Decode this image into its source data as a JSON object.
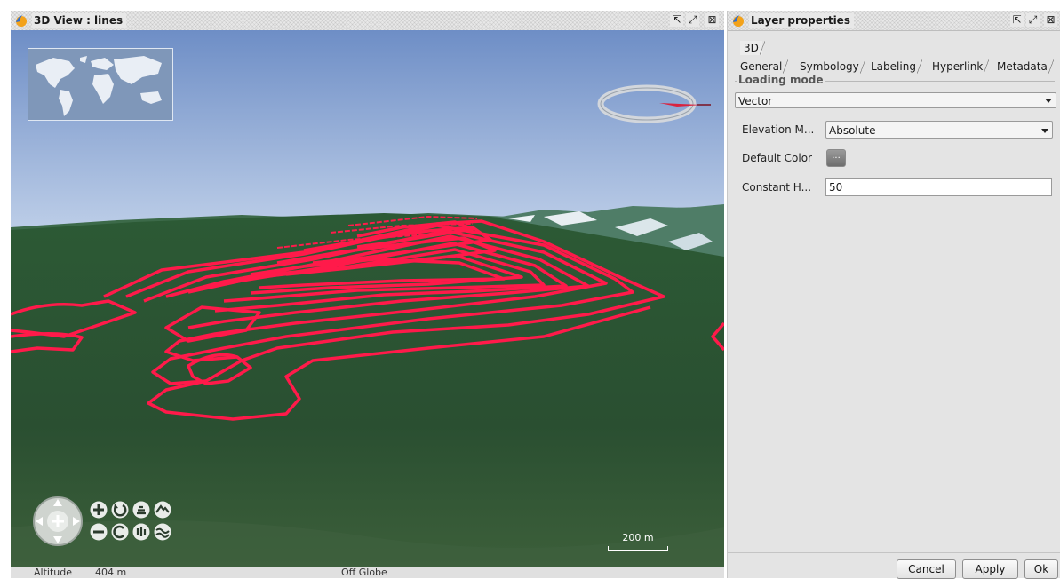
{
  "left_panel": {
    "title": "3D View : lines",
    "title_icon": "globe-flame-icon",
    "window_buttons": [
      "undock-icon",
      "maximize-icon",
      "close-icon"
    ],
    "scale_bar": "200 m",
    "status": {
      "altitude_label": "Altitude",
      "altitude_value": "404 m",
      "globe_status": "Off Globe"
    },
    "colors": {
      "sky_top": "#6f8fc7",
      "sky_horizon": "#bccde6",
      "terrain": "#2f5a36",
      "contour_lines": "#ff1a4a"
    },
    "nav_icons": [
      "zoom-in-icon",
      "rotate-left-icon",
      "tilt-up-icon",
      "terrain-up-icon",
      "zoom-out-icon",
      "rotate-right-icon",
      "tilt-down-icon",
      "terrain-down-icon"
    ]
  },
  "right_panel": {
    "title": "Layer properties",
    "title_icon": "globe-flame-icon",
    "window_buttons": [
      "undock-icon",
      "maximize-icon",
      "close-icon"
    ],
    "tabs_row1": [
      "3D"
    ],
    "tabs_row2": [
      "General",
      "Symbology",
      "Labeling",
      "Hyperlink",
      "Metadata"
    ],
    "loading_mode": {
      "legend": "Loading mode",
      "value": "Vector"
    },
    "fields": {
      "elevation_label": "Elevation M...",
      "elevation_value": "Absolute",
      "color_label": "Default Color",
      "color_button": "...",
      "height_label": "Constant H...",
      "height_value": "50"
    },
    "buttons": {
      "cancel": "Cancel",
      "apply": "Apply",
      "ok": "Ok"
    }
  }
}
